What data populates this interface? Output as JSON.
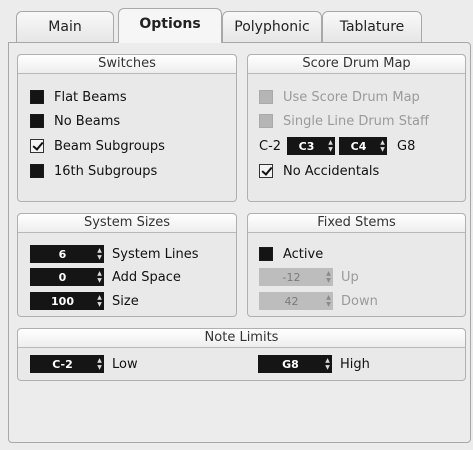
{
  "tabs": [
    {
      "label": "Main",
      "active": false
    },
    {
      "label": "Options",
      "active": true
    },
    {
      "label": "Polyphonic",
      "active": false
    },
    {
      "label": "Tablature",
      "active": false
    }
  ],
  "switches": {
    "title": "Switches",
    "items": [
      {
        "label": "Flat Beams",
        "checked": false
      },
      {
        "label": "No Beams",
        "checked": false
      },
      {
        "label": "Beam Subgroups",
        "checked": true
      },
      {
        "label": "16th Subgroups",
        "checked": false
      }
    ]
  },
  "score_drum_map": {
    "title": "Score Drum Map",
    "use_score_drum_map": "Use Score Drum Map",
    "single_line_drum_staff": "Single Line Drum Staff",
    "range_low_label": "C-2",
    "range_from": "C3",
    "range_to": "C4",
    "range_high_label": "G8",
    "no_accidentals": "No Accidentals"
  },
  "system_sizes": {
    "title": "System Sizes",
    "system_lines_value": "6",
    "system_lines_label": "System Lines",
    "add_space_value": "0",
    "add_space_label": "Add Space",
    "size_value": "100",
    "size_label": "Size"
  },
  "fixed_stems": {
    "title": "Fixed Stems",
    "active_label": "Active",
    "up_value": "-12",
    "up_label": "Up",
    "down_value": "42",
    "down_label": "Down"
  },
  "note_limits": {
    "title": "Note Limits",
    "low_value": "C-2",
    "low_label": "Low",
    "high_value": "G8",
    "high_label": "High"
  }
}
